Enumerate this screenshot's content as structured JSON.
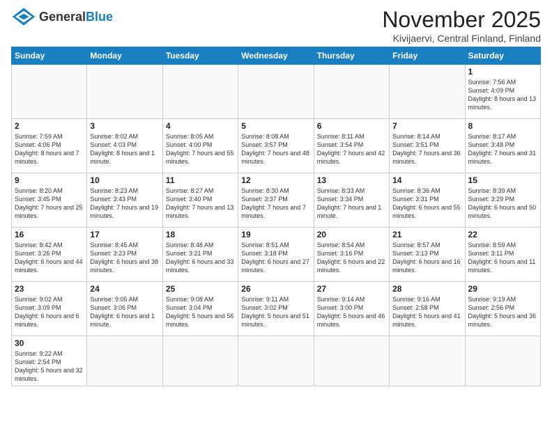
{
  "header": {
    "logo_general": "General",
    "logo_blue": "Blue",
    "title": "November 2025",
    "subtitle": "Kivijaervi, Central Finland, Finland"
  },
  "weekdays": [
    "Sunday",
    "Monday",
    "Tuesday",
    "Wednesday",
    "Thursday",
    "Friday",
    "Saturday"
  ],
  "weeks": [
    [
      {
        "day": "",
        "info": ""
      },
      {
        "day": "",
        "info": ""
      },
      {
        "day": "",
        "info": ""
      },
      {
        "day": "",
        "info": ""
      },
      {
        "day": "",
        "info": ""
      },
      {
        "day": "",
        "info": ""
      },
      {
        "day": "1",
        "info": "Sunrise: 7:56 AM\nSunset: 4:09 PM\nDaylight: 8 hours\nand 13 minutes."
      }
    ],
    [
      {
        "day": "2",
        "info": "Sunrise: 7:59 AM\nSunset: 4:06 PM\nDaylight: 8 hours\nand 7 minutes."
      },
      {
        "day": "3",
        "info": "Sunrise: 8:02 AM\nSunset: 4:03 PM\nDaylight: 8 hours\nand 1 minute."
      },
      {
        "day": "4",
        "info": "Sunrise: 8:05 AM\nSunset: 4:00 PM\nDaylight: 7 hours\nand 55 minutes."
      },
      {
        "day": "5",
        "info": "Sunrise: 8:08 AM\nSunset: 3:57 PM\nDaylight: 7 hours\nand 48 minutes."
      },
      {
        "day": "6",
        "info": "Sunrise: 8:11 AM\nSunset: 3:54 PM\nDaylight: 7 hours\nand 42 minutes."
      },
      {
        "day": "7",
        "info": "Sunrise: 8:14 AM\nSunset: 3:51 PM\nDaylight: 7 hours\nand 36 minutes."
      },
      {
        "day": "8",
        "info": "Sunrise: 8:17 AM\nSunset: 3:48 PM\nDaylight: 7 hours\nand 31 minutes."
      }
    ],
    [
      {
        "day": "9",
        "info": "Sunrise: 8:20 AM\nSunset: 3:45 PM\nDaylight: 7 hours\nand 25 minutes."
      },
      {
        "day": "10",
        "info": "Sunrise: 8:23 AM\nSunset: 3:43 PM\nDaylight: 7 hours\nand 19 minutes."
      },
      {
        "day": "11",
        "info": "Sunrise: 8:27 AM\nSunset: 3:40 PM\nDaylight: 7 hours\nand 13 minutes."
      },
      {
        "day": "12",
        "info": "Sunrise: 8:30 AM\nSunset: 3:37 PM\nDaylight: 7 hours\nand 7 minutes."
      },
      {
        "day": "13",
        "info": "Sunrise: 8:33 AM\nSunset: 3:34 PM\nDaylight: 7 hours\nand 1 minute."
      },
      {
        "day": "14",
        "info": "Sunrise: 8:36 AM\nSunset: 3:31 PM\nDaylight: 6 hours\nand 55 minutes."
      },
      {
        "day": "15",
        "info": "Sunrise: 8:39 AM\nSunset: 3:29 PM\nDaylight: 6 hours\nand 50 minutes."
      }
    ],
    [
      {
        "day": "16",
        "info": "Sunrise: 8:42 AM\nSunset: 3:26 PM\nDaylight: 6 hours\nand 44 minutes."
      },
      {
        "day": "17",
        "info": "Sunrise: 8:45 AM\nSunset: 3:23 PM\nDaylight: 6 hours\nand 38 minutes."
      },
      {
        "day": "18",
        "info": "Sunrise: 8:48 AM\nSunset: 3:21 PM\nDaylight: 6 hours\nand 33 minutes."
      },
      {
        "day": "19",
        "info": "Sunrise: 8:51 AM\nSunset: 3:18 PM\nDaylight: 6 hours\nand 27 minutes."
      },
      {
        "day": "20",
        "info": "Sunrise: 8:54 AM\nSunset: 3:16 PM\nDaylight: 6 hours\nand 22 minutes."
      },
      {
        "day": "21",
        "info": "Sunrise: 8:57 AM\nSunset: 3:13 PM\nDaylight: 6 hours\nand 16 minutes."
      },
      {
        "day": "22",
        "info": "Sunrise: 8:59 AM\nSunset: 3:11 PM\nDaylight: 6 hours\nand 11 minutes."
      }
    ],
    [
      {
        "day": "23",
        "info": "Sunrise: 9:02 AM\nSunset: 3:09 PM\nDaylight: 6 hours\nand 6 minutes."
      },
      {
        "day": "24",
        "info": "Sunrise: 9:05 AM\nSunset: 3:06 PM\nDaylight: 6 hours\nand 1 minute."
      },
      {
        "day": "25",
        "info": "Sunrise: 9:08 AM\nSunset: 3:04 PM\nDaylight: 5 hours\nand 56 minutes."
      },
      {
        "day": "26",
        "info": "Sunrise: 9:11 AM\nSunset: 3:02 PM\nDaylight: 5 hours\nand 51 minutes."
      },
      {
        "day": "27",
        "info": "Sunrise: 9:14 AM\nSunset: 3:00 PM\nDaylight: 5 hours\nand 46 minutes."
      },
      {
        "day": "28",
        "info": "Sunrise: 9:16 AM\nSunset: 2:58 PM\nDaylight: 5 hours\nand 41 minutes."
      },
      {
        "day": "29",
        "info": "Sunrise: 9:19 AM\nSunset: 2:56 PM\nDaylight: 5 hours\nand 36 minutes."
      }
    ],
    [
      {
        "day": "30",
        "info": "Sunrise: 9:22 AM\nSunset: 2:54 PM\nDaylight: 5 hours\nand 32 minutes."
      },
      {
        "day": "",
        "info": ""
      },
      {
        "day": "",
        "info": ""
      },
      {
        "day": "",
        "info": ""
      },
      {
        "day": "",
        "info": ""
      },
      {
        "day": "",
        "info": ""
      },
      {
        "day": "",
        "info": ""
      }
    ]
  ]
}
